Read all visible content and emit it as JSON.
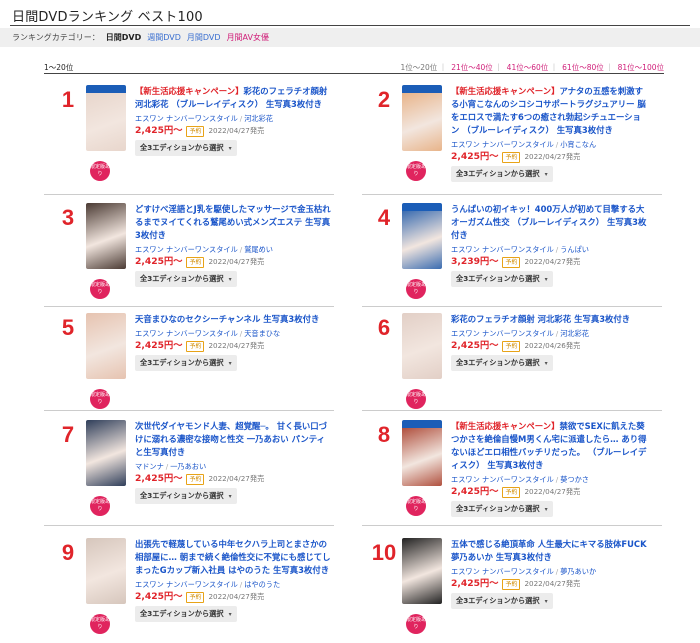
{
  "page_title": "日間DVDランキング ベスト100",
  "category_bar": {
    "label": "ランキングカテゴリー：",
    "active": "日間DVD",
    "links": [
      "週間DVD",
      "月間DVD",
      "月間AV女優"
    ]
  },
  "pagination": {
    "range": "1〜20位",
    "pages": [
      "1位〜20位",
      "21位〜40位",
      "41位〜60位",
      "61位〜80位",
      "81位〜100位"
    ]
  },
  "common": {
    "limited_badge": "限定版あり",
    "edition_button": "全3エディションから選択",
    "preorder": "予約",
    "chevron": "▾"
  },
  "items": [
    {
      "rank": "1",
      "campaign": "【新生活応援キャンペーン】",
      "title": "彩花のフェラチオ顔射 河北彩花 （ブルーレイディスク） 生写真3枚付き",
      "maker": "エスワン ナンバーワンスタイル",
      "actress": "河北彩花",
      "price": "2,425円〜",
      "date": "2022/04/27発売",
      "bluray": true,
      "color": "#e8d6cc"
    },
    {
      "rank": "2",
      "campaign": "【新生活応援キャンペーン】",
      "title": "アナタの五感を刺激する小宵こなんのシコシコサポートラグジュアリー 脳をエロスで満たす6つの癒され勃起シチュエーション （ブルーレイディスク） 生写真3枚付き",
      "maker": "エスワン ナンバーワンスタイル",
      "actress": "小宵こなん",
      "price": "2,425円〜",
      "date": "2022/04/27発売",
      "bluray": true,
      "color": "#e8b48a"
    },
    {
      "rank": "3",
      "campaign": "",
      "title": "どすけべ淫語とJ乳を駆使したマッサージで金玉枯れるまでヌイてくれる鷲尾めい式メンズエステ 生写真3枚付き",
      "maker": "エスワン ナンバーワンスタイル",
      "actress": "鷲尾めい",
      "price": "2,425円〜",
      "date": "2022/04/27発売",
      "bluray": false,
      "color": "#4a3a33"
    },
    {
      "rank": "4",
      "campaign": "",
      "title": "うんぱいの初イキッ！400万人が初めて目撃する大オーガズム性交 （ブルーレイディスク） 生写真3枚付き",
      "maker": "エスワン ナンバーワンスタイル",
      "actress": "うんぱい",
      "price": "3,239円〜",
      "date": "2022/04/27発売",
      "bluray": true,
      "color": "#3a6cb0"
    },
    {
      "rank": "5",
      "campaign": "",
      "title": "天音まひなのセクシーチャンネル 生写真3枚付き",
      "maker": "エスワン ナンバーワンスタイル",
      "actress": "天音まひな",
      "price": "2,425円〜",
      "date": "2022/04/27発売",
      "bluray": false,
      "color": "#e6c3b0"
    },
    {
      "rank": "6",
      "campaign": "",
      "title": "彩花のフェラチオ顔射 河北彩花 生写真3枚付き",
      "maker": "エスワン ナンバーワンスタイル",
      "actress": "河北彩花",
      "price": "2,425円〜",
      "date": "2022/04/26発売",
      "bluray": false,
      "color": "#e2cfc6"
    },
    {
      "rank": "7",
      "campaign": "",
      "title": "次世代ダイヤモンド人妻、超覚醒─。 甘く長い口づけに溺れる濃密な接吻と性交 一乃あおい パンティと生写真付き",
      "maker": "マドンナ",
      "actress": "一乃あおい",
      "price": "2,425円〜",
      "date": "2022/04/27発売",
      "bluray": false,
      "color": "#2f3e5a"
    },
    {
      "rank": "8",
      "campaign": "【新生活応援キャンペーン】",
      "title": "禁欲でSEXに飢えた葵つかさを絶倫自慢M男くん宅に派遣したら… あり得ないほどエロ相性バッチリだった。 （ブルーレイディスク） 生写真3枚付き",
      "maker": "エスワン ナンバーワンスタイル",
      "actress": "葵つかさ",
      "price": "2,425円〜",
      "date": "2022/04/27発売",
      "bluray": true,
      "color": "#b0503e"
    },
    {
      "rank": "9",
      "campaign": "",
      "title": "出張先で軽蔑している中年セクハラ上司とまさかの相部屋に… 朝まで続く絶倫性交に不覚にも感じてしまったGカップ新入社員 はやのうた 生写真3枚付き",
      "maker": "エスワン ナンバーワンスタイル",
      "actress": "はやのうた",
      "price": "2,425円〜",
      "date": "2022/04/27発売",
      "bluray": false,
      "color": "#d6c6bc"
    },
    {
      "rank": "10",
      "campaign": "",
      "title": "五体で感じる絶頂革命 人生最大にキマる肢体FUCK 夢乃あいか 生写真3枚付き",
      "maker": "エスワン ナンバーワンスタイル",
      "actress": "夢乃あいか",
      "price": "2,425円〜",
      "date": "2022/04/27発売",
      "bluray": false,
      "color": "#222222"
    }
  ]
}
